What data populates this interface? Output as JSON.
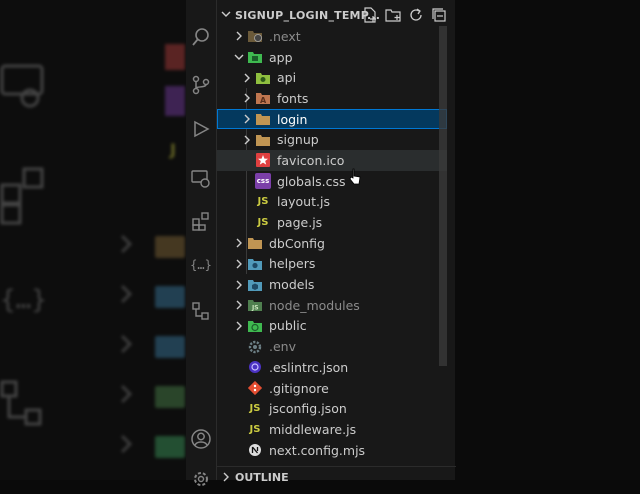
{
  "explorer": {
    "title": "SIGNUP_LOGIN_TEMP...",
    "outline_label": "OUTLINE"
  },
  "tree": [
    {
      "label": ".next",
      "depth": 1,
      "type": "folder",
      "dim": true
    },
    {
      "label": "app",
      "depth": 1,
      "type": "folder",
      "open": true
    },
    {
      "label": "api",
      "depth": 2,
      "type": "folder"
    },
    {
      "label": "fonts",
      "depth": 2,
      "type": "folder"
    },
    {
      "label": "login",
      "depth": 2,
      "type": "folder",
      "selected": true
    },
    {
      "label": "signup",
      "depth": 2,
      "type": "folder"
    },
    {
      "label": "favicon.ico",
      "depth": 2,
      "type": "file",
      "hover": true
    },
    {
      "label": "globals.css",
      "depth": 2,
      "type": "file"
    },
    {
      "label": "layout.js",
      "depth": 2,
      "type": "file"
    },
    {
      "label": "page.js",
      "depth": 2,
      "type": "file"
    },
    {
      "label": "dbConfig",
      "depth": 1,
      "type": "folder"
    },
    {
      "label": "helpers",
      "depth": 1,
      "type": "folder"
    },
    {
      "label": "models",
      "depth": 1,
      "type": "folder"
    },
    {
      "label": "node_modules",
      "depth": 1,
      "type": "folder",
      "dim": true
    },
    {
      "label": "public",
      "depth": 1,
      "type": "folder"
    },
    {
      "label": ".env",
      "depth": 1,
      "type": "file",
      "dim": true
    },
    {
      "label": ".eslintrc.json",
      "depth": 1,
      "type": "file"
    },
    {
      "label": ".gitignore",
      "depth": 1,
      "type": "file"
    },
    {
      "label": "jsconfig.json",
      "depth": 1,
      "type": "file"
    },
    {
      "label": "middleware.js",
      "depth": 1,
      "type": "file"
    },
    {
      "label": "next.config.mjs",
      "depth": 1,
      "type": "file"
    }
  ],
  "icons": {
    "js_label": "JS",
    "css_label": "css",
    "colors": {
      "accent": "#0078d4",
      "selected_bg": "#04395e",
      "folder": "#c09553",
      "js": "#cbcb41",
      "css": "#a074c4",
      "green": "#3fb950",
      "blue": "#519aba"
    }
  }
}
